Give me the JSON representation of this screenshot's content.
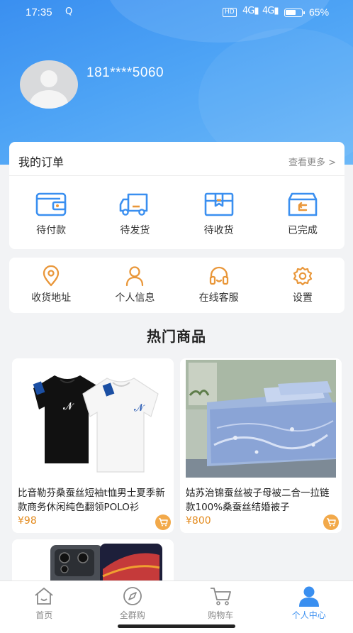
{
  "colors": {
    "primary": "#3a8ff0",
    "accent": "#e9973a",
    "price": "#e38a1d"
  },
  "status_bar": {
    "time": "17:35",
    "loop_icon": "Q",
    "hd": "HD",
    "signal1": "4G",
    "signal2": "4G",
    "battery_level": 0.65,
    "battery_text": "65%"
  },
  "profile": {
    "phone": "181****5060",
    "avatar_icon": "default-avatar-icon"
  },
  "orders": {
    "title": "我的订单",
    "more": "查看更多 >",
    "items": [
      {
        "label": "待付款",
        "icon": "wallet-icon"
      },
      {
        "label": "待发货",
        "icon": "truck-icon"
      },
      {
        "label": "待收货",
        "icon": "package-icon"
      },
      {
        "label": "已完成",
        "icon": "completed-box-icon"
      }
    ]
  },
  "services": [
    {
      "label": "收货地址",
      "icon": "location-pin-icon"
    },
    {
      "label": "个人信息",
      "icon": "user-icon"
    },
    {
      "label": "在线客服",
      "icon": "headset-icon"
    },
    {
      "label": "设置",
      "icon": "settings-icon"
    }
  ],
  "hot": {
    "title": "热门商品",
    "products": [
      {
        "name": "比音勒芬桑蚕丝短袖t恤男士夏季新款商务休闲纯色翻领POLO衫",
        "price": "¥98"
      },
      {
        "name": "姑苏治锦蚕丝被子母被二合一拉链款100%桑蚕丝结婚被子",
        "price": "¥800"
      }
    ]
  },
  "tabbar": {
    "tabs": [
      {
        "label": "首页",
        "icon": "home-icon"
      },
      {
        "label": "全群购",
        "icon": "compass-icon"
      },
      {
        "label": "购物车",
        "icon": "cart-icon"
      },
      {
        "label": "个人中心",
        "icon": "profile-icon"
      }
    ],
    "active": "个人中心"
  }
}
